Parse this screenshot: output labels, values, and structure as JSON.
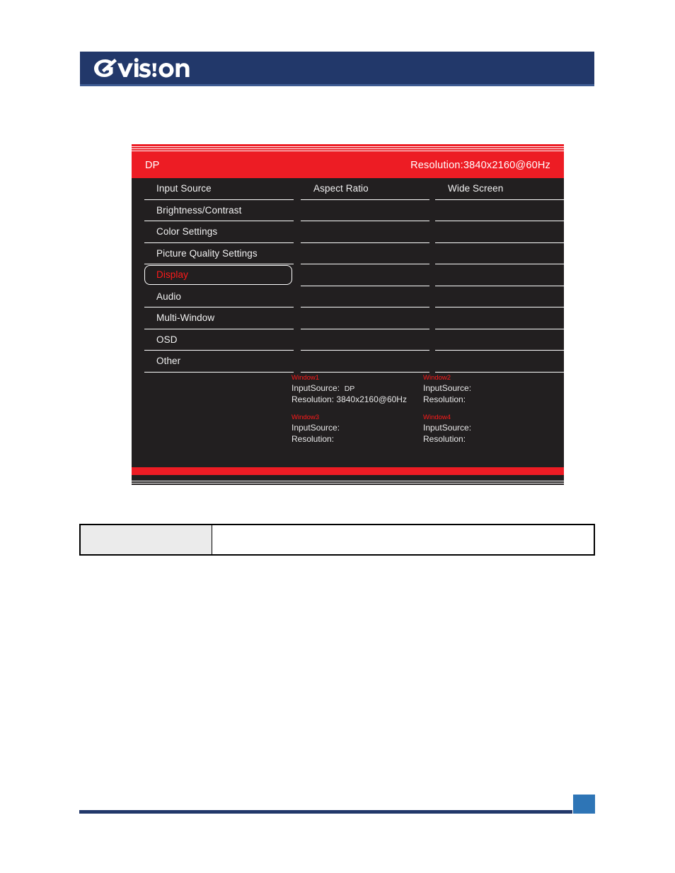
{
  "page": {
    "brand": "GVISION",
    "brand_icon": "gvision-logo",
    "header_color": "#22386a",
    "footer_accent_color": "#2e75b6"
  },
  "osd": {
    "accent_color": "#ed1c24",
    "background_color": "#221f20",
    "titlebar": {
      "input_source": "DP",
      "resolution": "Resolution:3840x2160@60Hz"
    },
    "menu_column": [
      {
        "label": "Input Source",
        "selected": false
      },
      {
        "label": "Brightness/Contrast",
        "selected": false
      },
      {
        "label": "Color Settings",
        "selected": false
      },
      {
        "label": "Picture Quality Settings",
        "selected": false
      },
      {
        "label": "Display",
        "selected": true
      },
      {
        "label": "Audio",
        "selected": false
      },
      {
        "label": "Multi-Window",
        "selected": false
      },
      {
        "label": "OSD",
        "selected": false
      },
      {
        "label": "Other",
        "selected": false
      }
    ],
    "submenu_column": [
      {
        "label": "Aspect Ratio"
      },
      {
        "label": ""
      },
      {
        "label": ""
      },
      {
        "label": ""
      },
      {
        "label": ""
      },
      {
        "label": ""
      },
      {
        "label": ""
      },
      {
        "label": ""
      },
      {
        "label": ""
      }
    ],
    "value_column": [
      {
        "label": "Wide Screen"
      },
      {
        "label": ""
      },
      {
        "label": ""
      },
      {
        "label": ""
      },
      {
        "label": ""
      },
      {
        "label": ""
      },
      {
        "label": ""
      },
      {
        "label": ""
      },
      {
        "label": ""
      }
    ],
    "windows": [
      {
        "title": "Window1",
        "input_source_label": "InputSource:",
        "input_source_value": "DP",
        "resolution_label": "Resolution:",
        "resolution_value": "3840x2160@60Hz"
      },
      {
        "title": "Window2",
        "input_source_label": "InputSource:",
        "input_source_value": "",
        "resolution_label": "Resolution:",
        "resolution_value": ""
      },
      {
        "title": "Window3",
        "input_source_label": "InputSource:",
        "input_source_value": "",
        "resolution_label": "Resolution:",
        "resolution_value": ""
      },
      {
        "title": "Window4",
        "input_source_label": "InputSource:",
        "input_source_value": "",
        "resolution_label": "Resolution:",
        "resolution_value": ""
      }
    ]
  },
  "caption_table": {
    "left_cell": "",
    "right_cell": ""
  }
}
